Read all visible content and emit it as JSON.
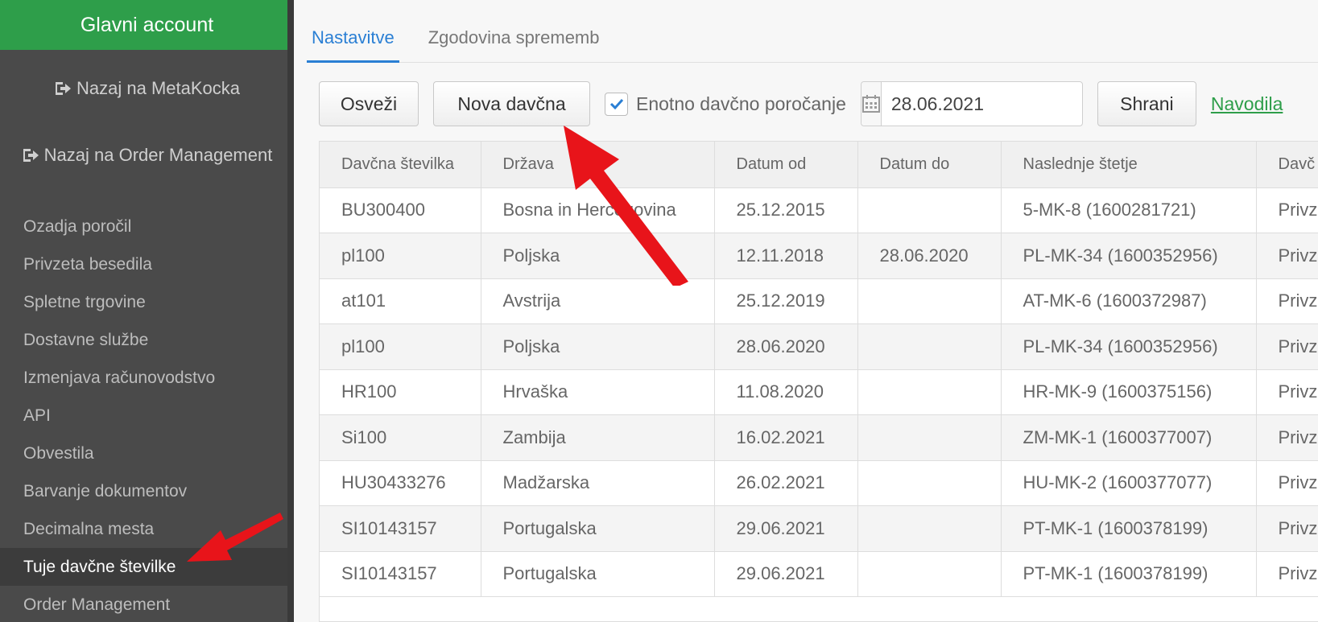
{
  "sidebar": {
    "header": "Glavni account",
    "back_metakocka": "Nazaj na MetaKocka",
    "back_order_management": "Nazaj na Order Management",
    "items": [
      {
        "label": "Ozadja poročil"
      },
      {
        "label": "Privzeta besedila"
      },
      {
        "label": "Spletne trgovine"
      },
      {
        "label": "Dostavne službe"
      },
      {
        "label": "Izmenjava računovodstvo"
      },
      {
        "label": "API"
      },
      {
        "label": "Obvestila"
      },
      {
        "label": "Barvanje dokumentov"
      },
      {
        "label": "Decimalna mesta"
      },
      {
        "label": "Tuje davčne številke"
      },
      {
        "label": "Order Management"
      }
    ],
    "active_item": "Tuje davčne številke"
  },
  "tabs": [
    {
      "label": "Nastavitve",
      "active": true
    },
    {
      "label": "Zgodovina sprememb",
      "active": false
    }
  ],
  "toolbar": {
    "refresh_label": "Osveži",
    "new_label": "Nova davčna",
    "unified_reporting_label": "Enotno davčno poročanje",
    "unified_reporting_checked": true,
    "date_value": "28.06.2021",
    "save_label": "Shrani",
    "help_label": "Navodila"
  },
  "table": {
    "headers": [
      "Davčna številka",
      "Država",
      "Datum od",
      "Datum do",
      "Naslednje štetje",
      "Davč"
    ],
    "rows": [
      [
        "BU300400",
        "Bosna in Hercegovina",
        "25.12.2015",
        "",
        "5-MK-8 (1600281721)",
        "Privz"
      ],
      [
        "pl100",
        "Poljska",
        "12.11.2018",
        "28.06.2020",
        "PL-MK-34 (1600352956)",
        "Privz"
      ],
      [
        "at101",
        "Avstrija",
        "25.12.2019",
        "",
        "AT-MK-6 (1600372987)",
        "Privz"
      ],
      [
        "pl100",
        "Poljska",
        "28.06.2020",
        "",
        "PL-MK-34 (1600352956)",
        "Privz"
      ],
      [
        "HR100",
        "Hrvaška",
        "11.08.2020",
        "",
        "HR-MK-9 (1600375156)",
        "Privz"
      ],
      [
        "Si100",
        "Zambija",
        "16.02.2021",
        "",
        "ZM-MK-1 (1600377007)",
        "Privz"
      ],
      [
        "HU30433276",
        "Madžarska",
        "26.02.2021",
        "",
        "HU-MK-2 (1600377077)",
        "Privz"
      ],
      [
        "SI10143157",
        "Portugalska",
        "29.06.2021",
        "",
        "PT-MK-1 (1600378199)",
        "Privz"
      ],
      [
        "SI10143157",
        "Portugalska",
        "29.06.2021",
        "",
        "PT-MK-1 (1600378199)",
        "Privz"
      ]
    ]
  },
  "colors": {
    "brand_green": "#2e9e4a",
    "sidebar_bg": "#4a4a4a",
    "tab_active": "#2a7fd4",
    "annotation_arrow": "#e8141a"
  },
  "icons": {
    "back": "sign-out-icon",
    "calendar": "calendar-icon",
    "checkbox": "check-icon"
  }
}
